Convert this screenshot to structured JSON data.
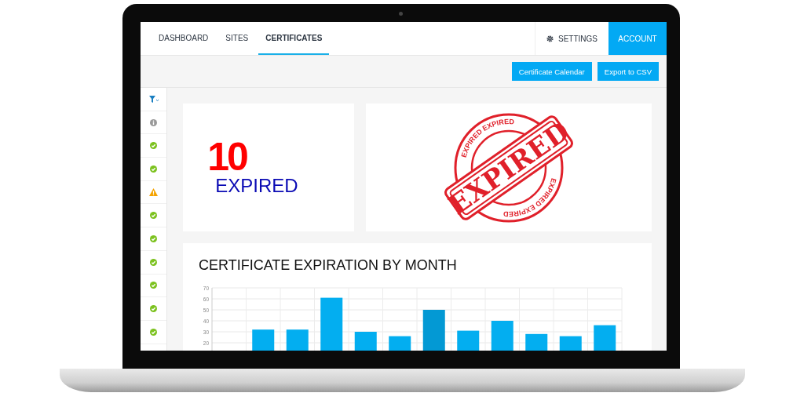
{
  "nav": {
    "tabs": [
      {
        "label": "DASHBOARD",
        "selected": false
      },
      {
        "label": "SITES",
        "selected": false
      },
      {
        "label": "CERTIFICATES",
        "selected": true
      }
    ],
    "settings": "SETTINGS",
    "account": "ACCOUNT"
  },
  "toolbar": {
    "buttons": [
      "Certificate Calendar",
      "Export to CSV"
    ]
  },
  "status_column": {
    "rows": [
      {
        "kind": "info"
      },
      {
        "kind": "ok"
      },
      {
        "kind": "ok"
      },
      {
        "kind": "warning"
      },
      {
        "kind": "ok"
      },
      {
        "kind": "ok"
      },
      {
        "kind": "ok"
      },
      {
        "kind": "ok"
      },
      {
        "kind": "ok"
      },
      {
        "kind": "ok"
      }
    ]
  },
  "summary": {
    "count": "10",
    "label": "EXPIRED"
  },
  "stamp": {
    "label": "EXPIRED",
    "ring_texts": [
      "EXPIRED EXPIRED",
      "EXPIRED EXPIRED"
    ]
  },
  "chart": {
    "title": "CERTIFICATE EXPIRATION BY MONTH",
    "chart_data": {
      "type": "bar",
      "values": [
        null,
        32,
        32,
        61,
        30,
        26,
        50,
        31,
        40,
        28,
        26,
        36
      ],
      "ylim": [
        10,
        70
      ],
      "grid": true,
      "yticks": [
        20,
        30,
        40,
        50,
        60,
        70
      ]
    }
  }
}
